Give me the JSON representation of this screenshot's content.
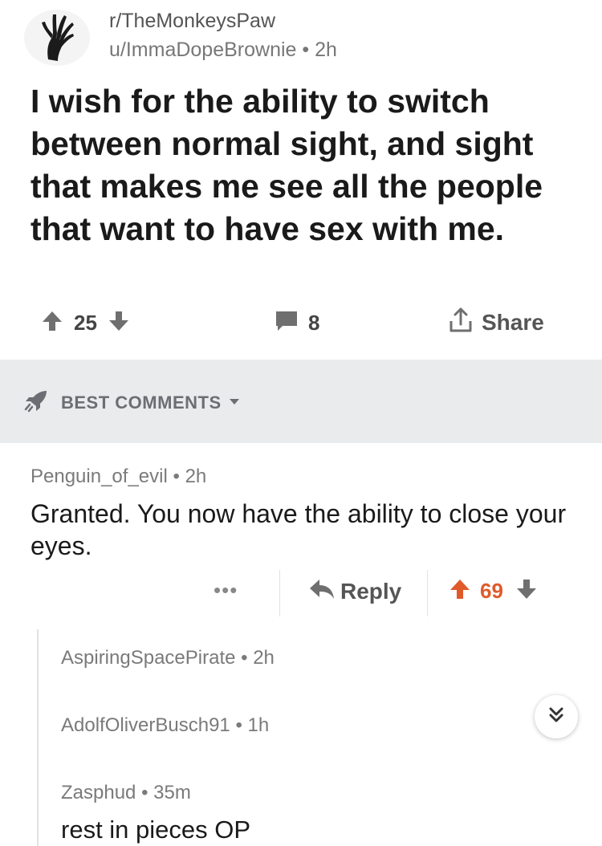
{
  "post": {
    "subreddit": "r/TheMonkeysPaw",
    "author": "u/ImmaDopeBrownie",
    "age": "2h",
    "meta_separator": "•",
    "title": "I wish for the ability to switch between normal sight, and sight that makes me see all the people that want to have sex with me.",
    "score": "25",
    "comment_count": "8",
    "share_label": "Share"
  },
  "sort": {
    "label": "BEST COMMENTS",
    "icon": "rocket-icon"
  },
  "top_comment": {
    "author": "Penguin_of_evil",
    "age": "2h",
    "body": "Granted. You now have the ability to close your eyes.",
    "more_label": "•••",
    "reply_label": "Reply",
    "score": "69"
  },
  "replies": [
    {
      "author": "AspiringSpacePirate",
      "age": "2h",
      "body": ""
    },
    {
      "author": "AdolfOliverBusch91",
      "age": "1h",
      "body": ""
    },
    {
      "author": "Zasphud",
      "age": "35m",
      "body": "rest in pieces OP"
    }
  ],
  "colors": {
    "upvote_active": "#e05a2a",
    "vote_neutral": "#6f6f6f",
    "sort_bar_bg": "#e9ebec",
    "meta_text": "#7a7a7a"
  },
  "icons": [
    "monkey-paw-icon",
    "upvote-icon",
    "downvote-icon",
    "comment-icon",
    "share-icon",
    "rocket-icon",
    "chevron-down-icon",
    "reply-arrow-icon",
    "double-chevron-down-icon"
  ]
}
